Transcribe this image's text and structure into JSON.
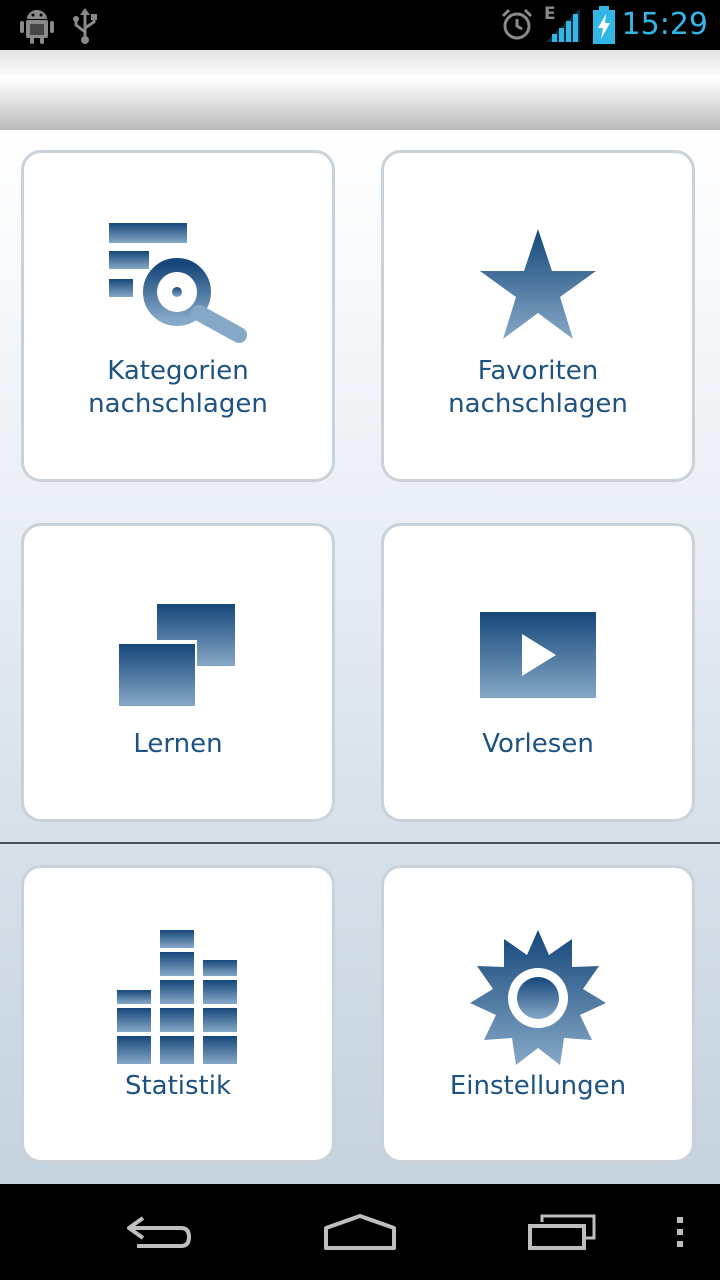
{
  "status_bar": {
    "time": "15:29",
    "network_label": "E",
    "battery_charging": true,
    "icons": [
      "android-debug-icon",
      "usb-icon",
      "alarm-icon",
      "signal-icon",
      "battery-icon"
    ]
  },
  "colors": {
    "accent": "#33b5e5",
    "tile_text": "#1d5283",
    "icon_dark": "#15477a",
    "icon_light": "#86a8c7"
  },
  "tiles": [
    {
      "id": "kategorien",
      "label_line1": "Kategorien",
      "label_line2": "nachschlagen",
      "icon": "category-search-icon"
    },
    {
      "id": "favoriten",
      "label_line1": "Favoriten",
      "label_line2": "nachschlagen",
      "icon": "star-icon"
    },
    {
      "id": "lernen",
      "label": "Lernen",
      "icon": "cards-icon"
    },
    {
      "id": "vorlesen",
      "label": "Vorlesen",
      "icon": "play-icon"
    },
    {
      "id": "statistik",
      "label": "Statistik",
      "icon": "bar-chart-icon"
    },
    {
      "id": "einstellungen",
      "label": "Einstellungen",
      "icon": "gear-icon"
    }
  ],
  "nav_bar": {
    "buttons": [
      "back-icon",
      "home-icon",
      "recents-icon",
      "overflow-menu-icon"
    ]
  }
}
